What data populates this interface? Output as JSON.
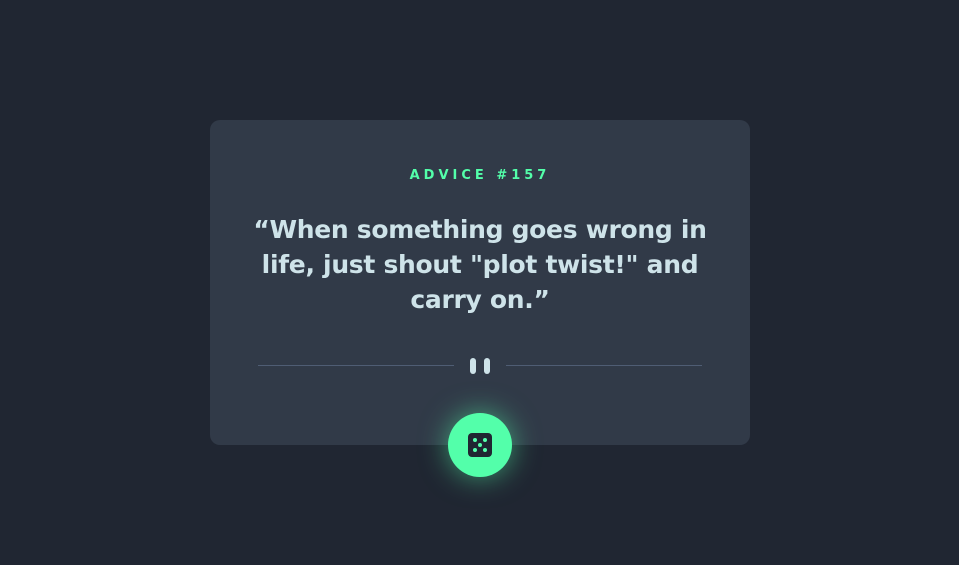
{
  "card": {
    "title": "ADVICE #157",
    "quote": "“When something goes wrong in life, just shout \"plot twist!\" and carry on.”"
  },
  "divider": {
    "icon": "pause-icon"
  },
  "dice_button": {
    "icon": "dice-icon"
  },
  "colors": {
    "background": "#202632",
    "card": "#313a48",
    "accent": "#53ffaa",
    "text": "#cee3e9",
    "divider": "#4f5d74"
  }
}
